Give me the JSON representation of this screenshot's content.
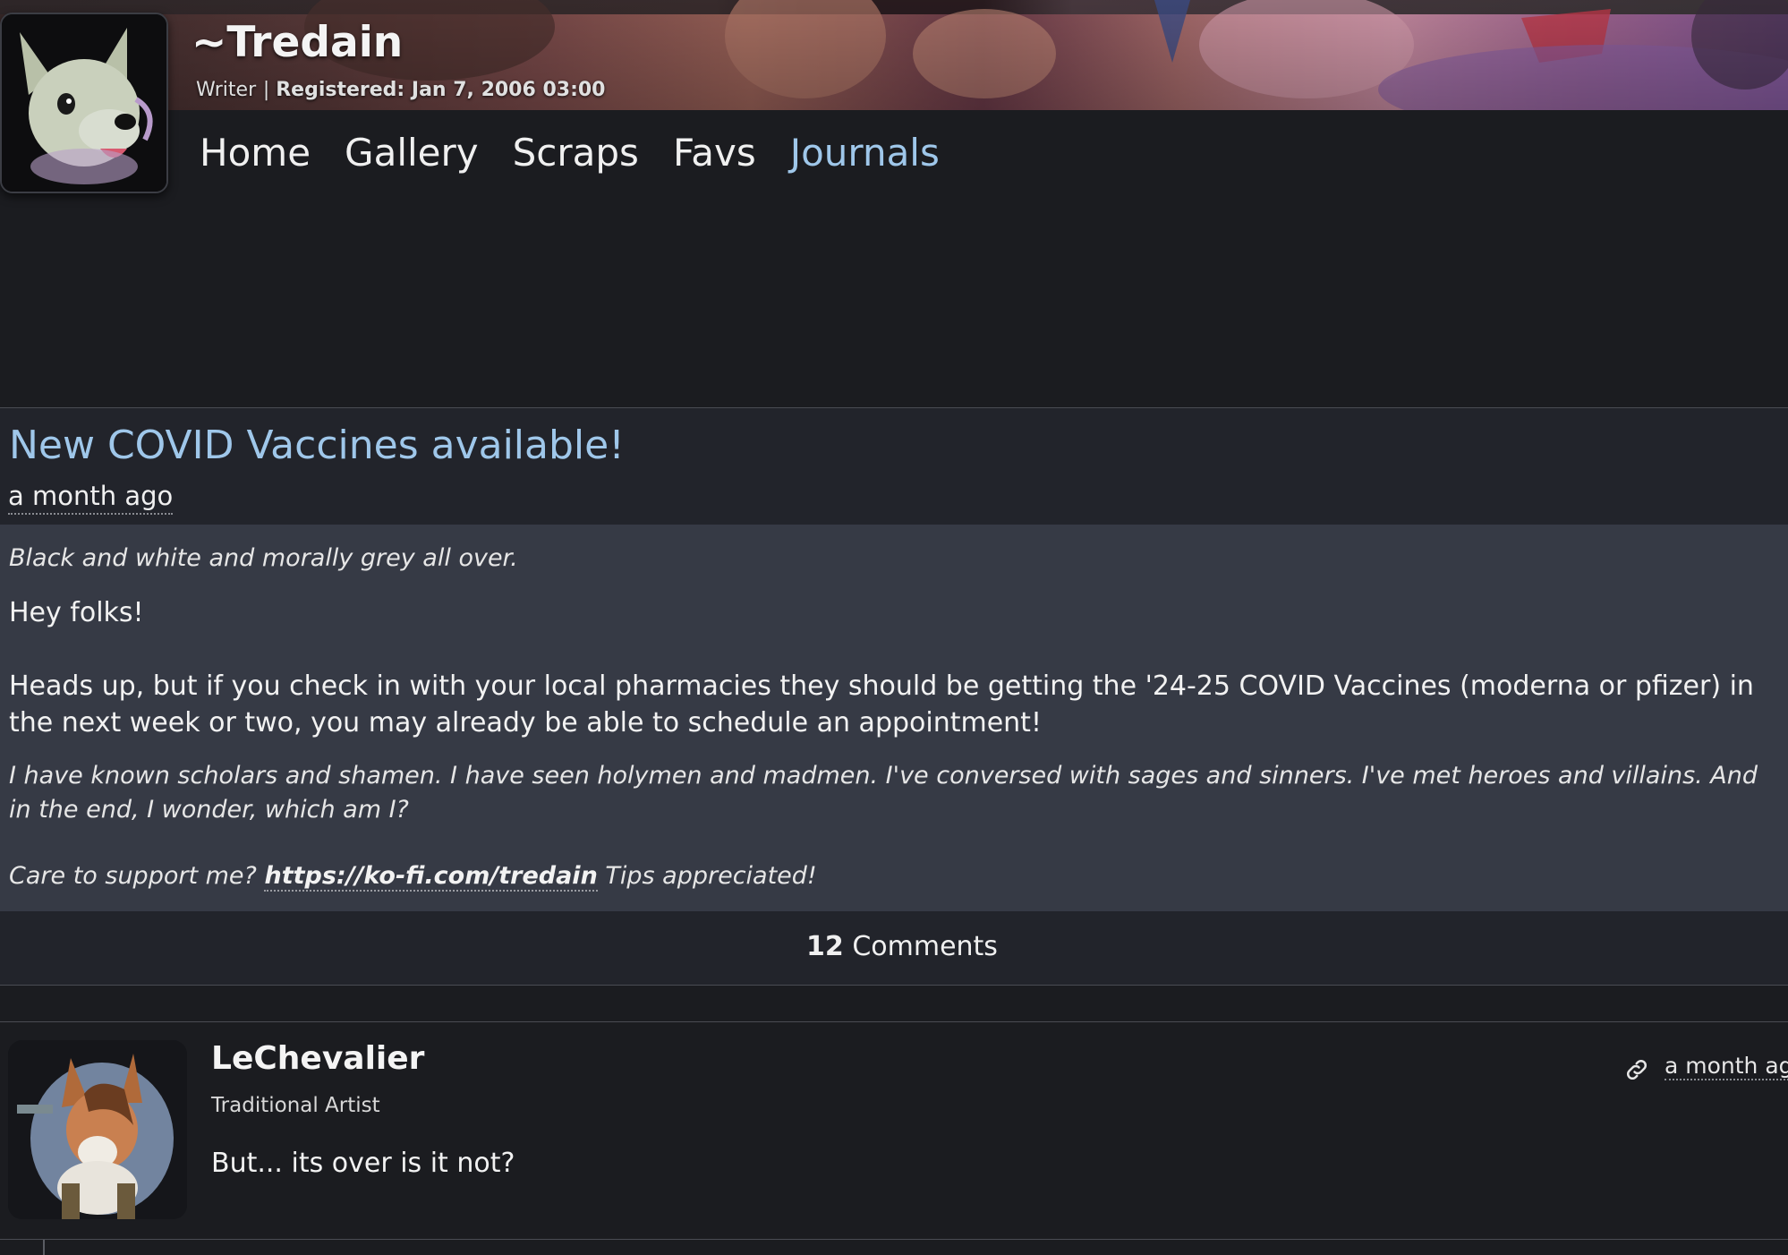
{
  "profile": {
    "username": "~Tredain",
    "role": "Writer",
    "registered_label": "Registered:",
    "registered_date": "Jan 7, 2006 03:00"
  },
  "nav": {
    "home": "Home",
    "gallery": "Gallery",
    "scraps": "Scraps",
    "favs": "Favs",
    "journals": "Journals"
  },
  "journal": {
    "title": "New COVID Vaccines available!",
    "date": "a month ago",
    "header_quote": "Black and white and morally grey all over.",
    "greeting": "Hey folks!",
    "body": "Heads up, but if you check in with your local pharmacies they should be getting the '24-25 COVID Vaccines (moderna or pfizer) in the next week or two, you may already be able to schedule an appointment!",
    "footer_quote": "I have known scholars and shamen. I have seen holymen and madmen. I've conversed with sages and sinners. I've met heroes and villains. And in the end, I wonder, which am I?",
    "support_prefix": "Care to support me?",
    "support_link": "https://ko-fi.com/tredain",
    "support_suffix": "Tips appreciated!"
  },
  "comments": {
    "count": "12",
    "label": "Comments"
  },
  "comment": {
    "author": "LeChevalier",
    "author_title": "Traditional Artist",
    "text": "But... its over is it not?",
    "date": "a month ago"
  },
  "colors": {
    "background": "#1b1c20",
    "panel": "#22242b",
    "journal_body": "#363a45",
    "accent_link": "#9fc7ea"
  },
  "icons": {
    "permalink": "link-icon"
  }
}
